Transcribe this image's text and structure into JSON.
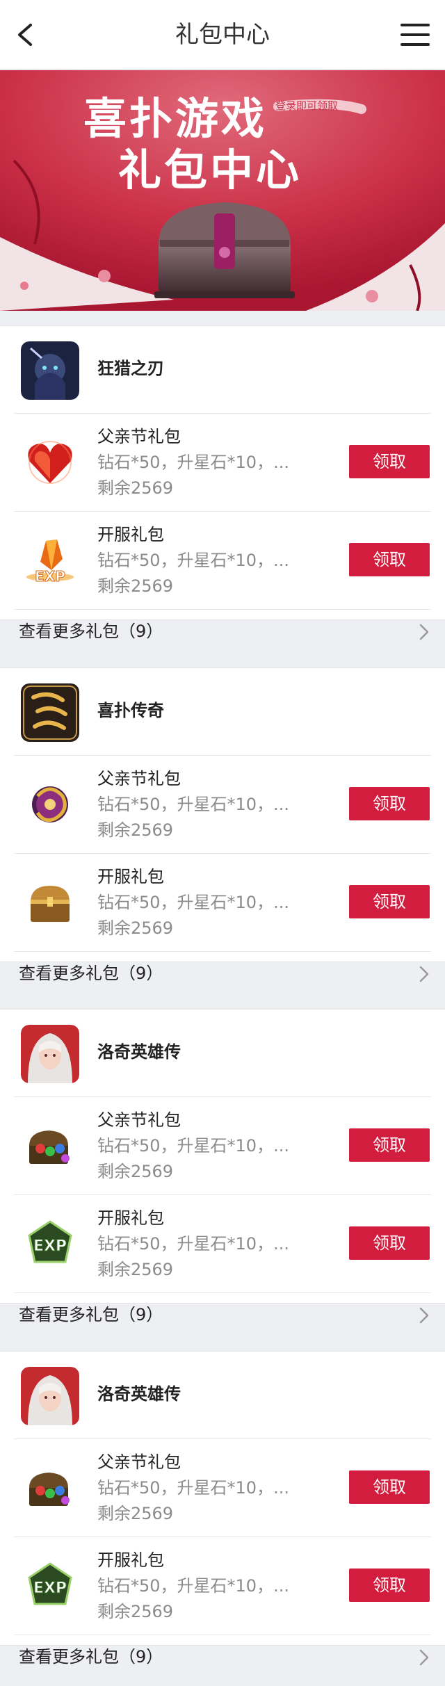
{
  "header": {
    "title": "礼包中心"
  },
  "banner": {
    "title_line1": "喜扑游戏",
    "title_line2": "礼包中心",
    "badge": "登录即可领取"
  },
  "claim_label": "领取",
  "sections": [
    {
      "game": "狂猎之刃",
      "gifts": [
        {
          "name": "父亲节礼包",
          "desc": "钻石*50，升星石*10，...",
          "remaining": "剩余2569"
        },
        {
          "name": "开服礼包",
          "desc": "钻石*50，升星石*10，...",
          "remaining": "剩余2569"
        }
      ],
      "more": "查看更多礼包（9）"
    },
    {
      "game": "喜扑传奇",
      "gifts": [
        {
          "name": "父亲节礼包",
          "desc": "钻石*50，升星石*10，...",
          "remaining": "剩余2569"
        },
        {
          "name": "开服礼包",
          "desc": "钻石*50，升星石*10，...",
          "remaining": "剩余2569"
        }
      ],
      "more": "查看更多礼包（9）"
    },
    {
      "game": "洛奇英雄传",
      "gifts": [
        {
          "name": "父亲节礼包",
          "desc": "钻石*50，升星石*10，...",
          "remaining": "剩余2569"
        },
        {
          "name": "开服礼包",
          "desc": "钻石*50，升星石*10，...",
          "remaining": "剩余2569"
        }
      ],
      "more": "查看更多礼包（9）"
    },
    {
      "game": "洛奇英雄传",
      "gifts": [
        {
          "name": "父亲节礼包",
          "desc": "钻石*50，升星石*10，...",
          "remaining": "剩余2569"
        },
        {
          "name": "开服礼包",
          "desc": "钻石*50，升星石*10，...",
          "remaining": "剩余2569"
        }
      ],
      "more": "查看更多礼包（9）"
    }
  ],
  "icons": {
    "section_0": {
      "game": "dark-warrior-icon",
      "gift_0": "red-heart-gem-icon",
      "gift_1": "exp-crystal-icon"
    },
    "section_1": {
      "game": "legend-calligraphy-icon",
      "gift_0": "purple-dragon-orb-icon",
      "gift_1": "treasure-chest-icon"
    },
    "section_2": {
      "game": "white-hair-heroine-icon",
      "gift_0": "gem-chest-icon",
      "gift_1": "exp-badge-icon"
    },
    "section_3": {
      "game": "white-hair-heroine-icon",
      "gift_0": "gem-chest-icon",
      "gift_1": "exp-badge-icon"
    }
  },
  "colors": {
    "accent": "#d31d3f",
    "banner": "#c7364c",
    "background": "#eeeff3"
  }
}
